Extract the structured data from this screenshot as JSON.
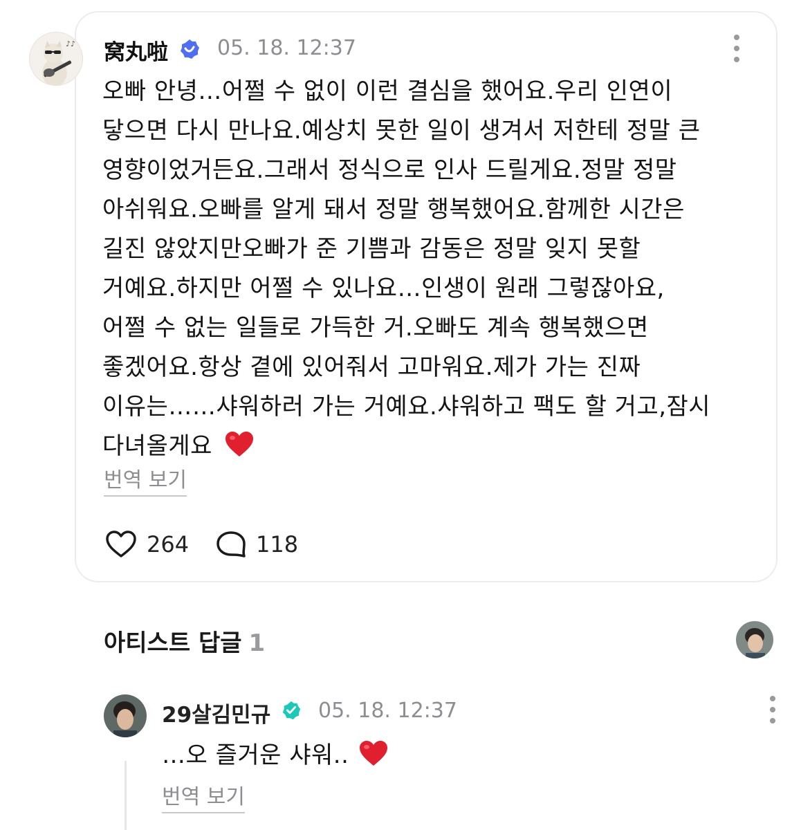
{
  "post": {
    "author": "窝丸啦",
    "timestamp": "05. 18. 12:37",
    "lines": [
      "오빠 안녕…어쩔 수 없이 이런 결심을 했어요.우리 인연이",
      "닿으면 다시 만나요.예상치 못한 일이 생겨서 저한테 정말 큰",
      "영향이었거든요.그래서 정식으로 인사 드릴게요.정말 정말",
      "아쉬워요.오빠를 알게 돼서 정말 행복했어요.함께한 시간은",
      "길진 않았지만오빠가 준 기쁨과 감동은 정말 잊지 못할",
      "거예요.하지만 어쩔 수 있나요…인생이 원래 그렇잖아요,",
      "어쩔 수 없는 일들로 가득한 거.오빠도 계속 행복했으면",
      "좋겠어요.항상 곁에 있어줘서 고마워요.제가 가는 진짜",
      "이유는……샤워하러 가는 거예요.샤워하고 팩도 할 거고,잠시",
      "다녀올게요"
    ],
    "translate_label": "번역 보기",
    "likes": "264",
    "comments": "118"
  },
  "artist_replies": {
    "title": "아티스트 답글",
    "count": "1"
  },
  "reply": {
    "author": "29살김민규",
    "timestamp": "05. 18. 12:37",
    "text": "…오 즐거운 샤워..",
    "translate_label": "번역 보기"
  },
  "colors": {
    "verified_blue": "#4f6ff0",
    "verified_teal": "#1ec8b8",
    "heart_red": "#e0202e"
  },
  "icons": {
    "verified": "verified-badge-icon",
    "more": "more-vertical-icon",
    "like": "heart-icon",
    "comment": "speech-bubble-icon",
    "emoji": "red-heart-emoji"
  }
}
